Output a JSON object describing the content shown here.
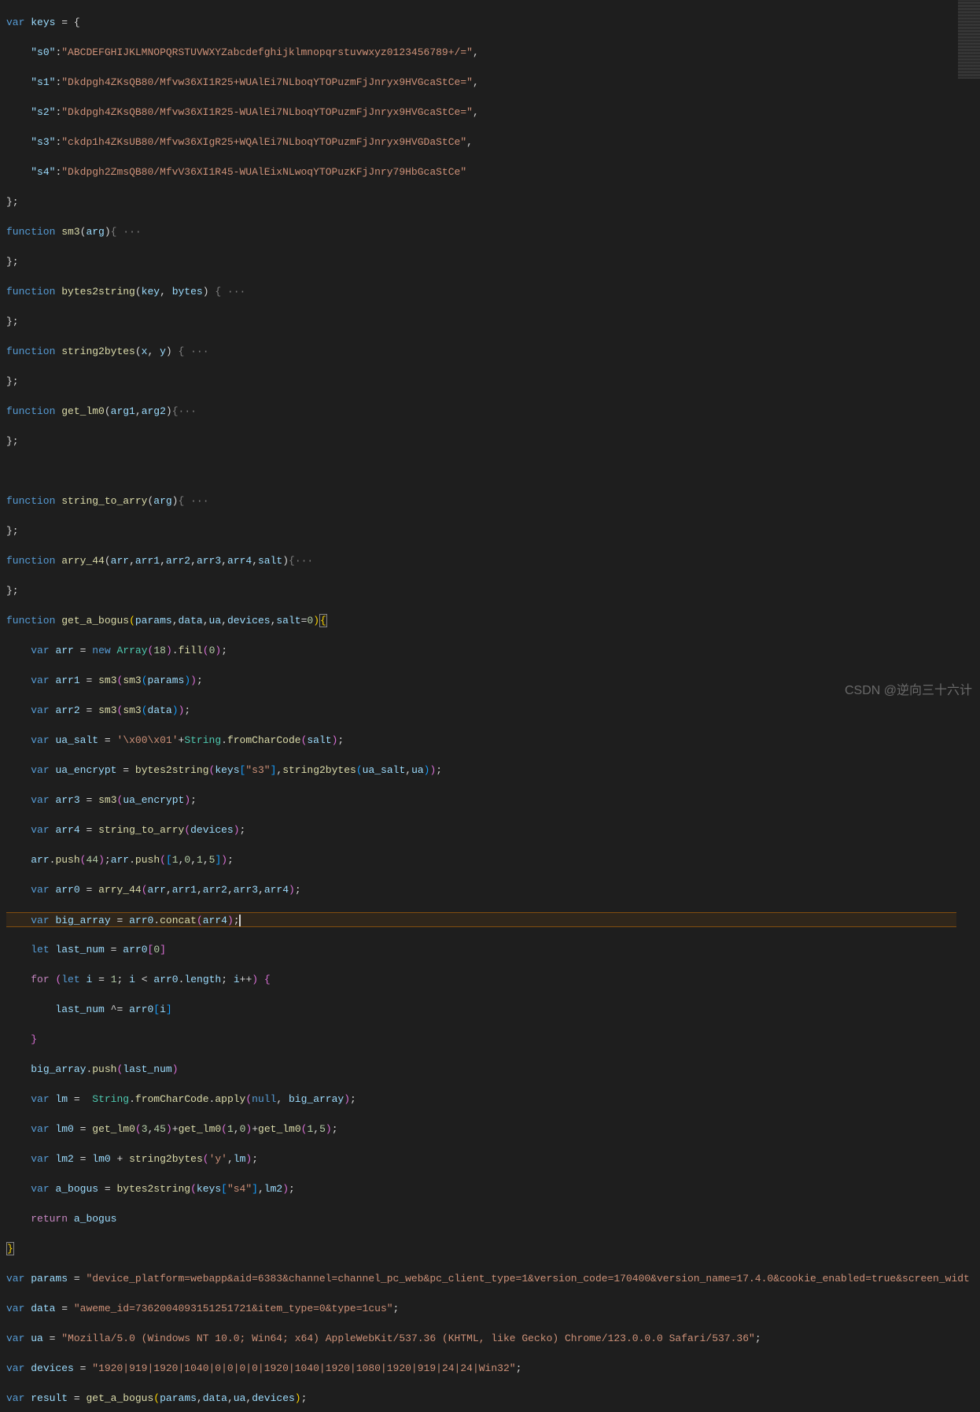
{
  "watermark": "CSDN @逆向三十六计",
  "code": {
    "keys_decl": "var",
    "keys_name": "keys",
    "keys_open": " = {",
    "s0_key": "\"s0\"",
    "s0_val": "\"ABCDEFGHIJKLMNOPQRSTUVWXYZabcdefghijklmnopqrstuvwxyz0123456789+/=\"",
    "s1_key": "\"s1\"",
    "s1_val": "\"Dkdpgh4ZKsQB80/Mfvw36XI1R25+WUAlEi7NLboqYTOPuzmFjJnryx9HVGcaStCe=\"",
    "s2_key": "\"s2\"",
    "s2_val": "\"Dkdpgh4ZKsQB80/Mfvw36XI1R25-WUAlEi7NLboqYTOPuzmFjJnryx9HVGcaStCe=\"",
    "s3_key": "\"s3\"",
    "s3_val": "\"ckdp1h4ZKsUB80/Mfvw36XIgR25+WQAlEi7NLboqYTOPuzmFjJnryx9HVGDaStCe\"",
    "s4_key": "\"s4\"",
    "s4_val": "\"Dkdpgh2ZmsQB80/MfvV36XI1R45-WUAlEixNLwoqYTOPuzKFjJnry79HbGcaStCe\"",
    "close_brace": "};",
    "fn_kw": "function",
    "sm3": "sm3",
    "sm3_params": "(arg)",
    "bytes2string": "bytes2string",
    "bytes2string_params": "(key, bytes)",
    "string2bytes": "string2bytes",
    "string2bytes_params": "(x, y)",
    "get_lm0": "get_lm0",
    "get_lm0_params": "(arg1,arg2)",
    "string_to_arry": "string_to_arry",
    "string_to_arry_params": "(arg)",
    "arry_44": "arry_44",
    "arry_44_params": "(arr,arr1,arr2,arr3,arr4,salt)",
    "get_a_bogus": "get_a_bogus",
    "get_a_bogus_params_1": "params",
    "get_a_bogus_params_2": "data",
    "get_a_bogus_params_3": "ua",
    "get_a_bogus_params_4": "devices",
    "get_a_bogus_params_5": "salt",
    "default_val": "0",
    "var_kw": "var",
    "let_kw": "let",
    "new_kw": "new",
    "for_kw": "for",
    "return_kw": "return",
    "arr": "arr",
    "arr1": "arr1",
    "arr2": "arr2",
    "arr3": "arr3",
    "arr4": "arr4",
    "arr0": "arr0",
    "Array": "Array",
    "n18": "18",
    "fill": "fill",
    "n0": "0",
    "ua_salt": "ua_salt",
    "ua_salt_str": "'\\x00\\x01'",
    "String": "String",
    "fromCharCode": "fromCharCode",
    "salt": "salt",
    "ua_encrypt": "ua_encrypt",
    "keys_s3": "\"s3\"",
    "keys_s4": "\"s4\"",
    "ua": "ua",
    "devices": "devices",
    "push": "push",
    "n44": "44",
    "arr_1015": "1,0,1,5",
    "big_array": "big_array",
    "concat": "concat",
    "last_num": "last_num",
    "length": "length",
    "i": "i",
    "n1": "1",
    "apply": "apply",
    "null": "null",
    "lm": "lm",
    "lm0": "lm0",
    "lm2": "lm2",
    "n3": "3",
    "n45": "45",
    "n5": "5",
    "y_str": "'y'",
    "a_bogus": "a_bogus",
    "params": "params",
    "data": "data",
    "result": "result",
    "params_str": "\"device_platform=webapp&aid=6383&channel=channel_pc_web&pc_client_type=1&version_code=170400&version_name=17.4.0&cookie_enabled=true&screen_widt",
    "data_str": "\"aweme_id=7362004093151251721&item_type=0&type=1cus\"",
    "ua_str": "\"Mozilla/5.0 (Windows NT 10.0; Win64; x64) AppleWebKit/537.36 (KHTML, like Gecko) Chrome/123.0.0.0 Safari/537.36\"",
    "devices_str": "\"1920|919|1920|1040|0|0|0|0|1920|1040|1920|1080|1920|919|24|24|Win32\"",
    "fold": "{ ···",
    "fold2": "{···"
  }
}
